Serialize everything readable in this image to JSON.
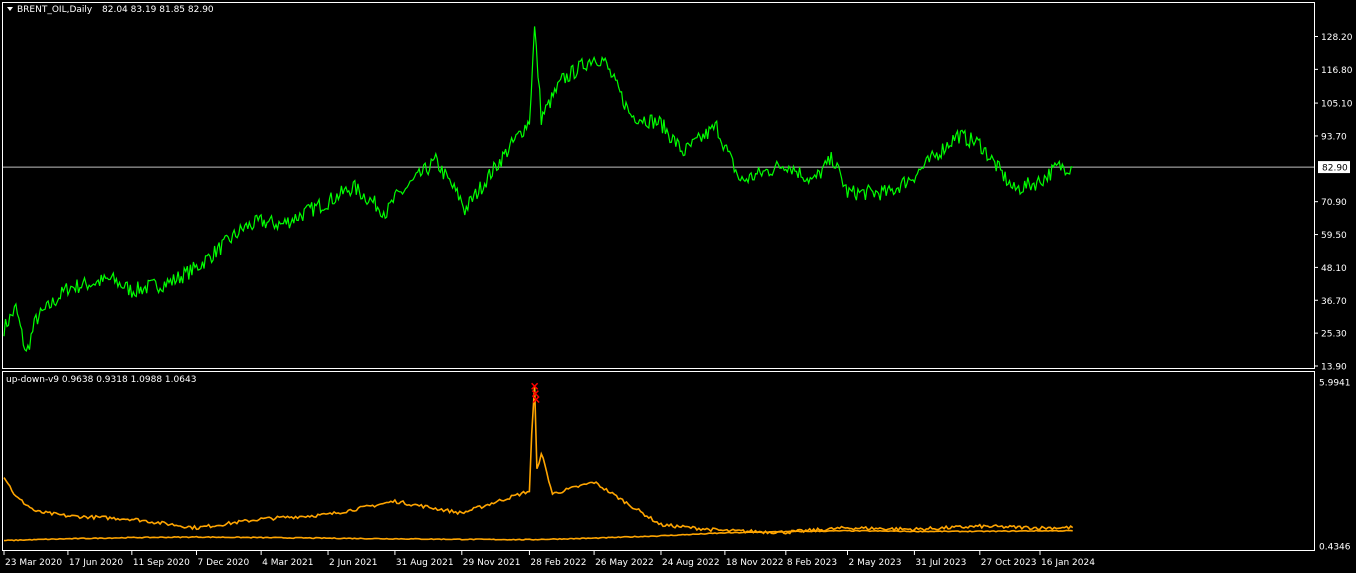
{
  "main": {
    "title": "BRENT_OIL,Daily",
    "ohlc": "82.04 83.19 81.85 82.90",
    "current_price": "82.90"
  },
  "indicator": {
    "title": "up-down-v9 0.9638 0.9318 1.0988 1.0643"
  },
  "colors": {
    "background": "#000000",
    "frame": "#ffffff",
    "price_line": "#00ff00",
    "indicator_line": "#ffa500",
    "marker": "#ff0000",
    "level_line": "#c0c0c0"
  },
  "chart_data": [
    {
      "type": "line",
      "title": "BRENT_OIL,Daily",
      "xlabel": "",
      "ylabel": "",
      "ylim": [
        13.9,
        136
      ],
      "y_ticks": [
        "128.20",
        "116.80",
        "105.10",
        "93.70",
        "82.90",
        "70.90",
        "59.50",
        "48.10",
        "36.70",
        "25.30",
        "13.90"
      ],
      "x_ticks": [
        "23 Mar 2020",
        "17 Jun 2020",
        "11 Sep 2020",
        "7 Dec 2020",
        "4 Mar 2021",
        "2 Jun 2021",
        "31 Aug 2021",
        "29 Nov 2021",
        "28 Feb 2022",
        "26 May 2022",
        "24 Aug 2022",
        "18 Nov 2022",
        "8 Feb 2023",
        "2 May 2023",
        "31 Jul 2023",
        "27 Oct 2023",
        "16 Jan 2024"
      ],
      "current_level": 82.9,
      "grid": false,
      "series": [
        {
          "x": [
            "23 Mar 2020",
            "8 Apr 2020",
            "22 Apr 2020",
            "5 May 2020",
            "17 Jun 2020",
            "15 Aug 2020",
            "11 Sep 2020",
            "2 Nov 2020",
            "7 Dec 2020",
            "10 Feb 2021",
            "4 Mar 2021",
            "1 Apr 2021",
            "2 Jun 2021",
            "6 Jul 2021",
            "20 Aug 2021",
            "31 Aug 2021",
            "25 Oct 2021",
            "29 Nov 2021",
            "3 Dec 2021",
            "5 Jan 2022",
            "28 Feb 2022",
            "7 Mar 2022",
            "16 Mar 2022",
            "13 Apr 2022",
            "26 May 2022",
            "8 Jun 2022",
            "14 Jul 2022",
            "24 Aug 2022",
            "23 Sep 2022",
            "7 Nov 2022",
            "18 Nov 2022",
            "9 Dec 2022",
            "8 Feb 2023",
            "17 Mar 2023",
            "12 Apr 2023",
            "2 May 2023",
            "27 Jun 2023",
            "31 Jul 2023",
            "27 Sep 2023",
            "27 Oct 2023",
            "12 Dec 2023",
            "16 Jan 2024",
            "9 Feb 2024",
            "29 Feb 2024"
          ],
          "values": [
            27,
            34,
            18,
            30,
            41,
            44,
            40,
            43,
            48,
            62,
            64,
            63,
            71,
            76,
            67,
            72,
            85,
            71,
            68,
            80,
            99,
            131,
            100,
            113,
            121,
            120,
            101,
            98,
            88,
            97,
            90,
            78,
            84,
            78,
            86,
            74,
            74,
            80,
            94,
            91,
            75,
            78,
            83,
            82.9
          ]
        }
      ]
    },
    {
      "type": "line",
      "title": "up-down-v9 0.9638 0.9318 1.0988 1.0643",
      "xlabel": "",
      "ylabel": "",
      "ylim": [
        0.4346,
        5.9941
      ],
      "y_ticks": [
        "5.9941",
        "0.4346"
      ],
      "grid": false,
      "series": [
        {
          "x": [
            "23 Mar 2020",
            "8 Apr 2020",
            "5 May 2020",
            "17 Jun 2020",
            "11 Sep 2020",
            "7 Dec 2020",
            "4 Mar 2021",
            "2 Jun 2021",
            "31 Aug 2021",
            "29 Nov 2021",
            "28 Feb 2022",
            "3 Mar 2022",
            "7 Mar 2022",
            "10 Mar 2022",
            "16 Mar 2022",
            "31 Mar 2022",
            "26 May 2022",
            "24 Aug 2022",
            "18 Nov 2022",
            "8 Feb 2023",
            "2 May 2023",
            "31 Jul 2023",
            "27 Oct 2023",
            "16 Jan 2024",
            "29 Feb 2024"
          ],
          "values": [
            2.8,
            2.1,
            1.6,
            1.45,
            1.35,
            1.05,
            1.35,
            1.5,
            1.95,
            1.55,
            2.3,
            4.2,
            5.85,
            3.0,
            3.6,
            2.2,
            2.6,
            1.15,
            0.95,
            0.9,
            1.05,
            1.0,
            1.1,
            1.05,
            1.06
          ]
        },
        {
          "x": [
            "23 Mar 2020",
            "17 Jun 2020",
            "11 Sep 2020",
            "7 Dec 2020",
            "4 Mar 2021",
            "2 Jun 2021",
            "31 Aug 2021",
            "29 Nov 2021",
            "28 Feb 2022",
            "26 May 2022",
            "24 Aug 2022",
            "18 Nov 2022",
            "8 Feb 2023",
            "2 May 2023",
            "31 Jul 2023",
            "27 Oct 2023",
            "16 Jan 2024",
            "29 Feb 2024"
          ],
          "values": [
            0.62,
            0.68,
            0.72,
            0.74,
            0.72,
            0.7,
            0.68,
            0.66,
            0.65,
            0.7,
            0.78,
            0.88,
            0.92,
            0.95,
            0.93,
            0.93,
            0.95,
            0.95
          ]
        }
      ],
      "markers": [
        {
          "x": "7 Mar 2022",
          "value": 5.85
        },
        {
          "x": "8 Mar 2022",
          "value": 5.6
        },
        {
          "x": "9 Mar 2022",
          "value": 5.4
        }
      ]
    }
  ]
}
